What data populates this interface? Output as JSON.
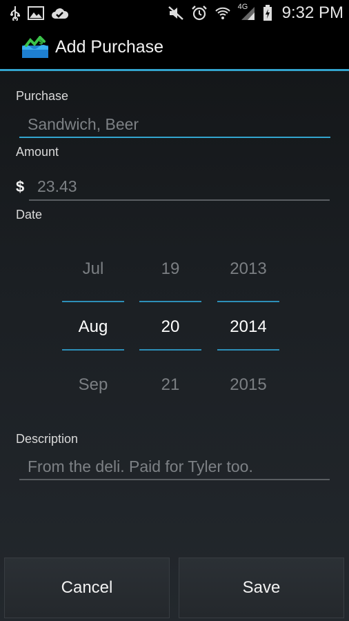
{
  "status_bar": {
    "time": "9:32 PM",
    "network": "4G"
  },
  "action_bar": {
    "title": "Add Purchase"
  },
  "form": {
    "purchase_label": "Purchase",
    "purchase_value": "Sandwich, Beer",
    "amount_label": "Amount",
    "currency_symbol": "$",
    "amount_value": "23.43",
    "date_label": "Date",
    "description_label": "Description",
    "description_value": "From the deli. Paid for Tyler too."
  },
  "date_picker": {
    "month": {
      "prev": "Jul",
      "selected": "Aug",
      "next": "Sep"
    },
    "day": {
      "prev": "19",
      "selected": "20",
      "next": "21"
    },
    "year": {
      "prev": "2013",
      "selected": "2014",
      "next": "2015"
    }
  },
  "buttons": {
    "cancel": "Cancel",
    "save": "Save"
  },
  "colors": {
    "accent": "#33a5cf",
    "background": "#1b1f23"
  }
}
